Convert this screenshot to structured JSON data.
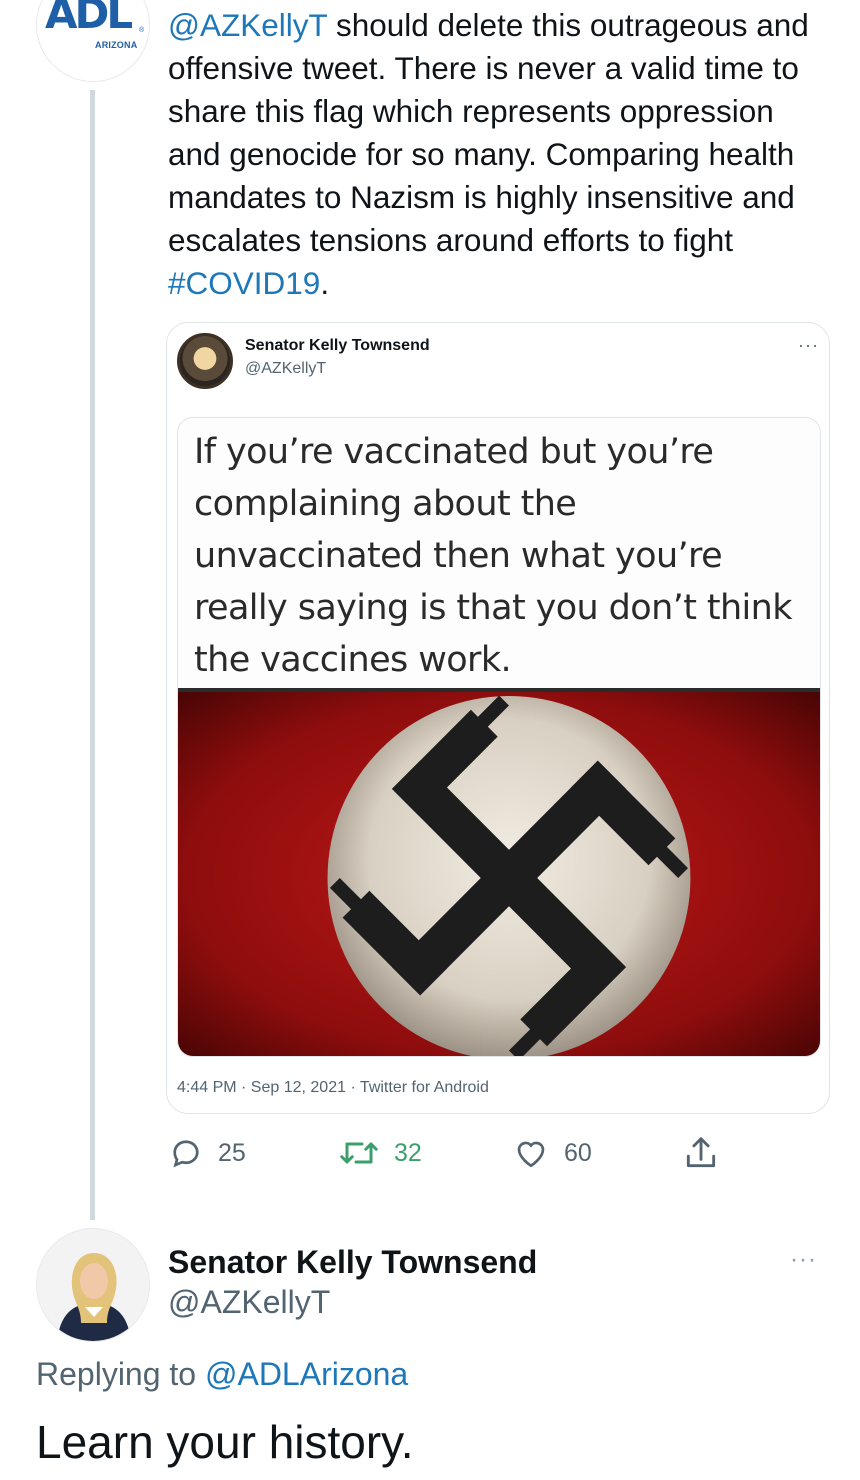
{
  "top_tweet": {
    "avatar_logo": "ADL",
    "avatar_logo_mark": "®",
    "avatar_subtitle": "ARIZONA",
    "mention": "@AZKellyT",
    "text_body": " should delete this outrageous and offensive tweet. There is never a valid time to share this flag which represents oppression and genocide for so many. Comparing health mandates to Nazism is highly insensitive and escalates tensions around efforts to fight ",
    "hashtag": "#COVID19",
    "text_end": "."
  },
  "quoted_tweet": {
    "name": "Senator Kelly Townsend",
    "handle": "@AZKellyT",
    "more_label": "···",
    "meme_text": "If you’re vaccinated but you’re complaining about the unvaccinated then what you’re really saying is that you don’t think the vaccines work.",
    "meta": "4:44 PM · Sep 12, 2021 · Twitter for Android"
  },
  "actions": {
    "replies": "25",
    "retweets": "32",
    "likes": "60"
  },
  "reply_tweet": {
    "name": "Senator Kelly Townsend",
    "handle": "@AZKellyT",
    "more_label": "···",
    "replying_prefix": "Replying to ",
    "replying_to": "@ADLArizona",
    "text": "Learn your history."
  },
  "colors": {
    "link": "#1d77b8",
    "retweet": "#3a9f6a",
    "muted": "#536471",
    "thread_line": "#cfd9de"
  }
}
